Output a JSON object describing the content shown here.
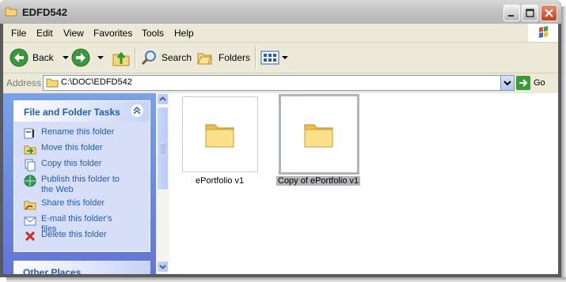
{
  "window": {
    "title": "EDFD542"
  },
  "menu": [
    "File",
    "Edit",
    "View",
    "Favorites",
    "Tools",
    "Help"
  ],
  "toolbar": {
    "back": "Back",
    "search": "Search",
    "folders": "Folders"
  },
  "address": {
    "label": "Address",
    "path": "C:\\DOC\\EDFD542",
    "go": "Go"
  },
  "tasks": {
    "title": "File and Folder Tasks",
    "items": [
      "Rename this folder",
      "Move this folder",
      "Copy this folder",
      "Publish this folder to the Web",
      "Share this folder",
      "E-mail this folder's files",
      "Delete this folder"
    ]
  },
  "other_places": {
    "title": "Other Places"
  },
  "files": [
    {
      "name": "ePortfolio v1",
      "selected": false
    },
    {
      "name": "Copy of ePortfolio v1",
      "selected": true
    }
  ],
  "colors": {
    "task_link": "#215dc6",
    "pane_gradient_top": "#7ba2e7",
    "pane_gradient_bottom": "#6375d6"
  }
}
